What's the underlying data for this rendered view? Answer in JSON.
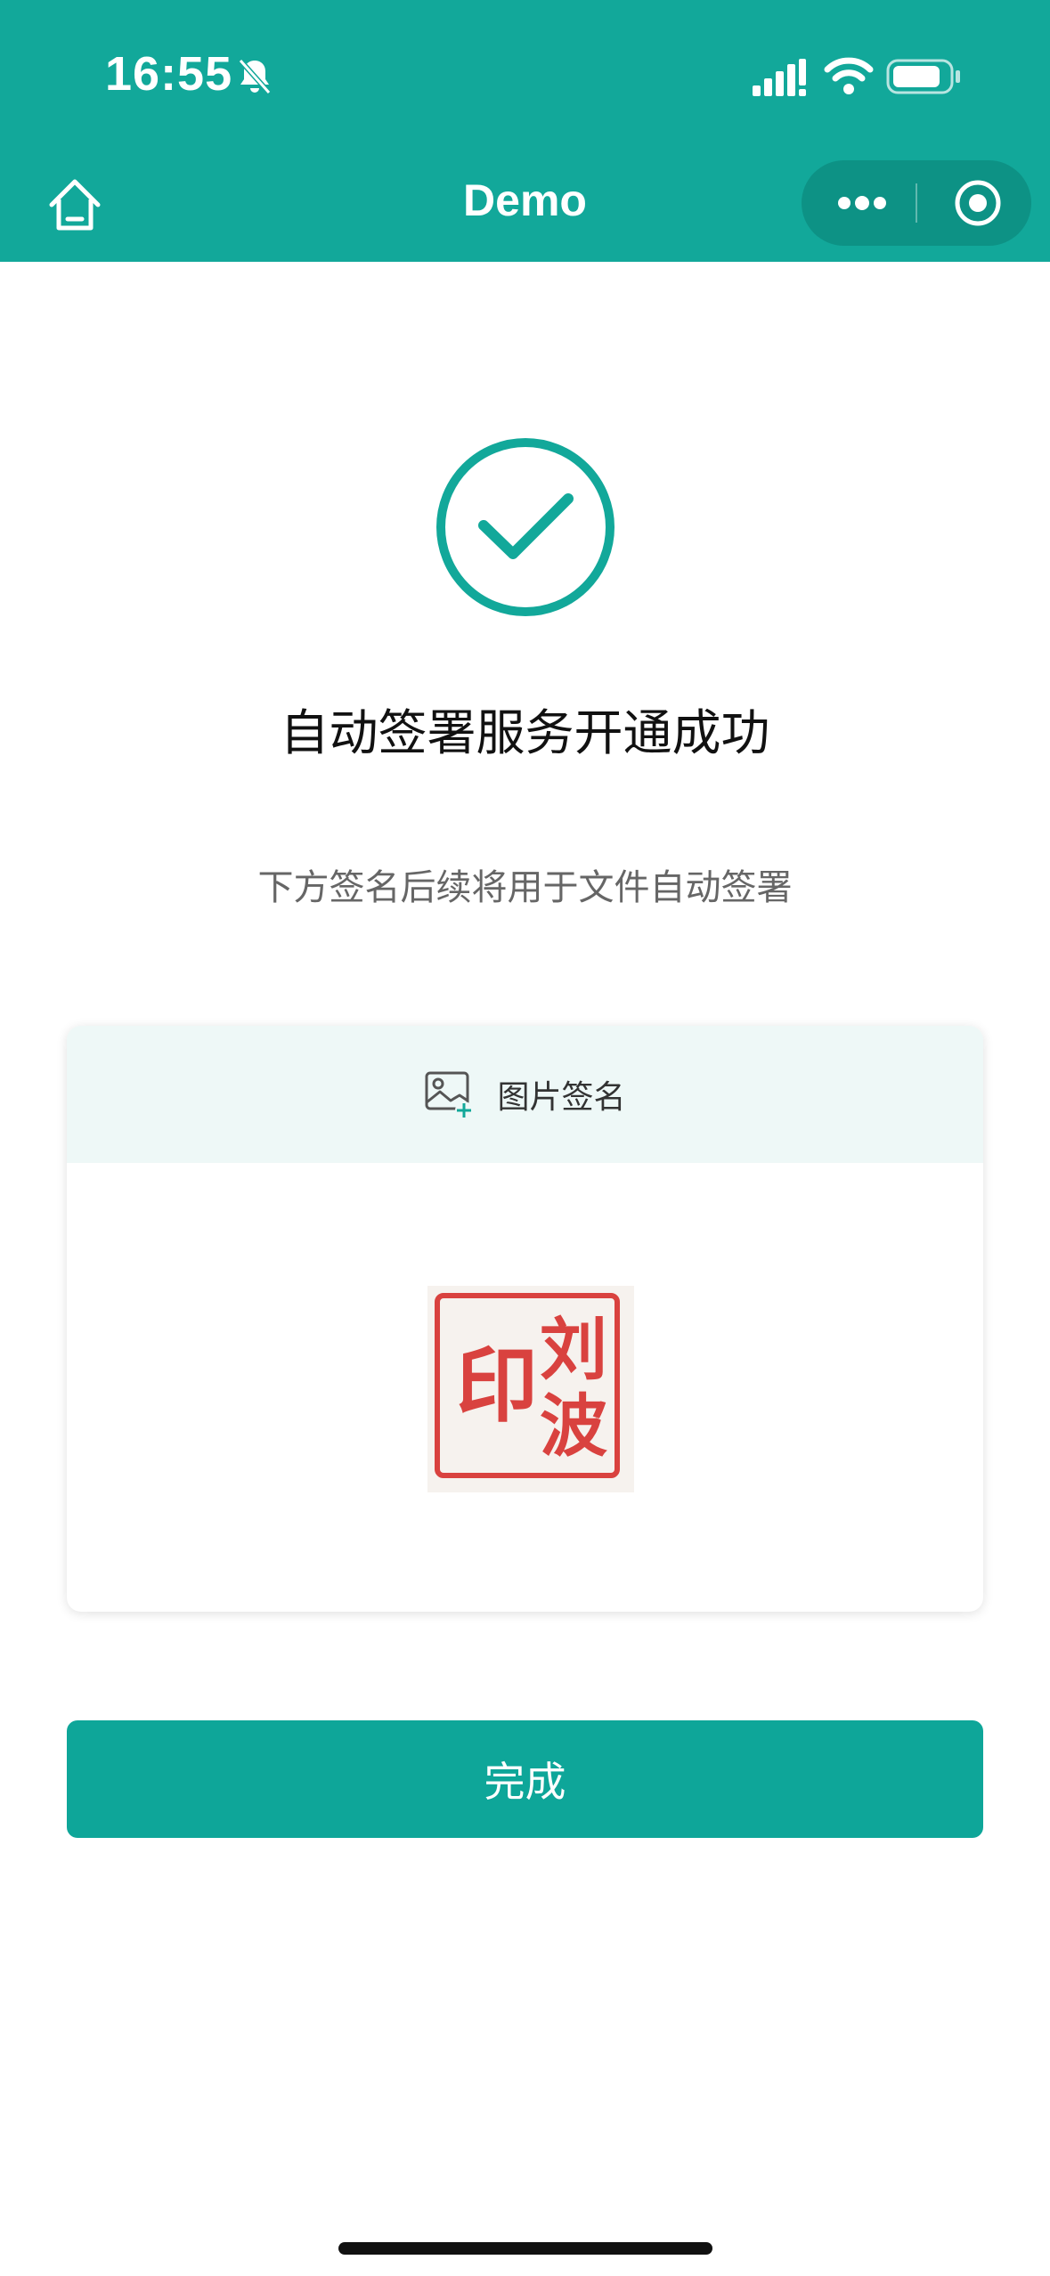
{
  "status_bar": {
    "time": "16:55"
  },
  "nav": {
    "title": "Demo"
  },
  "content": {
    "title": "自动签署服务开通成功",
    "subtitle": "下方签名后续将用于文件自动签署"
  },
  "card": {
    "tab_label": "图片签名",
    "seal_chars": [
      "印",
      "刘",
      "波"
    ]
  },
  "actions": {
    "done_label": "完成"
  },
  "colors": {
    "brand": "#12a89a",
    "button": "#0ea699",
    "seal": "#d9423f",
    "card_header_bg": "#eef8f7"
  },
  "icons": {
    "bell_off": "bell-off-icon",
    "signal": "cellular-signal-icon",
    "wifi": "wifi-icon",
    "battery": "battery-icon",
    "home": "home-icon",
    "more": "more-dots-icon",
    "close": "target-circle-icon",
    "success": "checkmark-circle-icon",
    "image_add": "image-add-icon"
  }
}
